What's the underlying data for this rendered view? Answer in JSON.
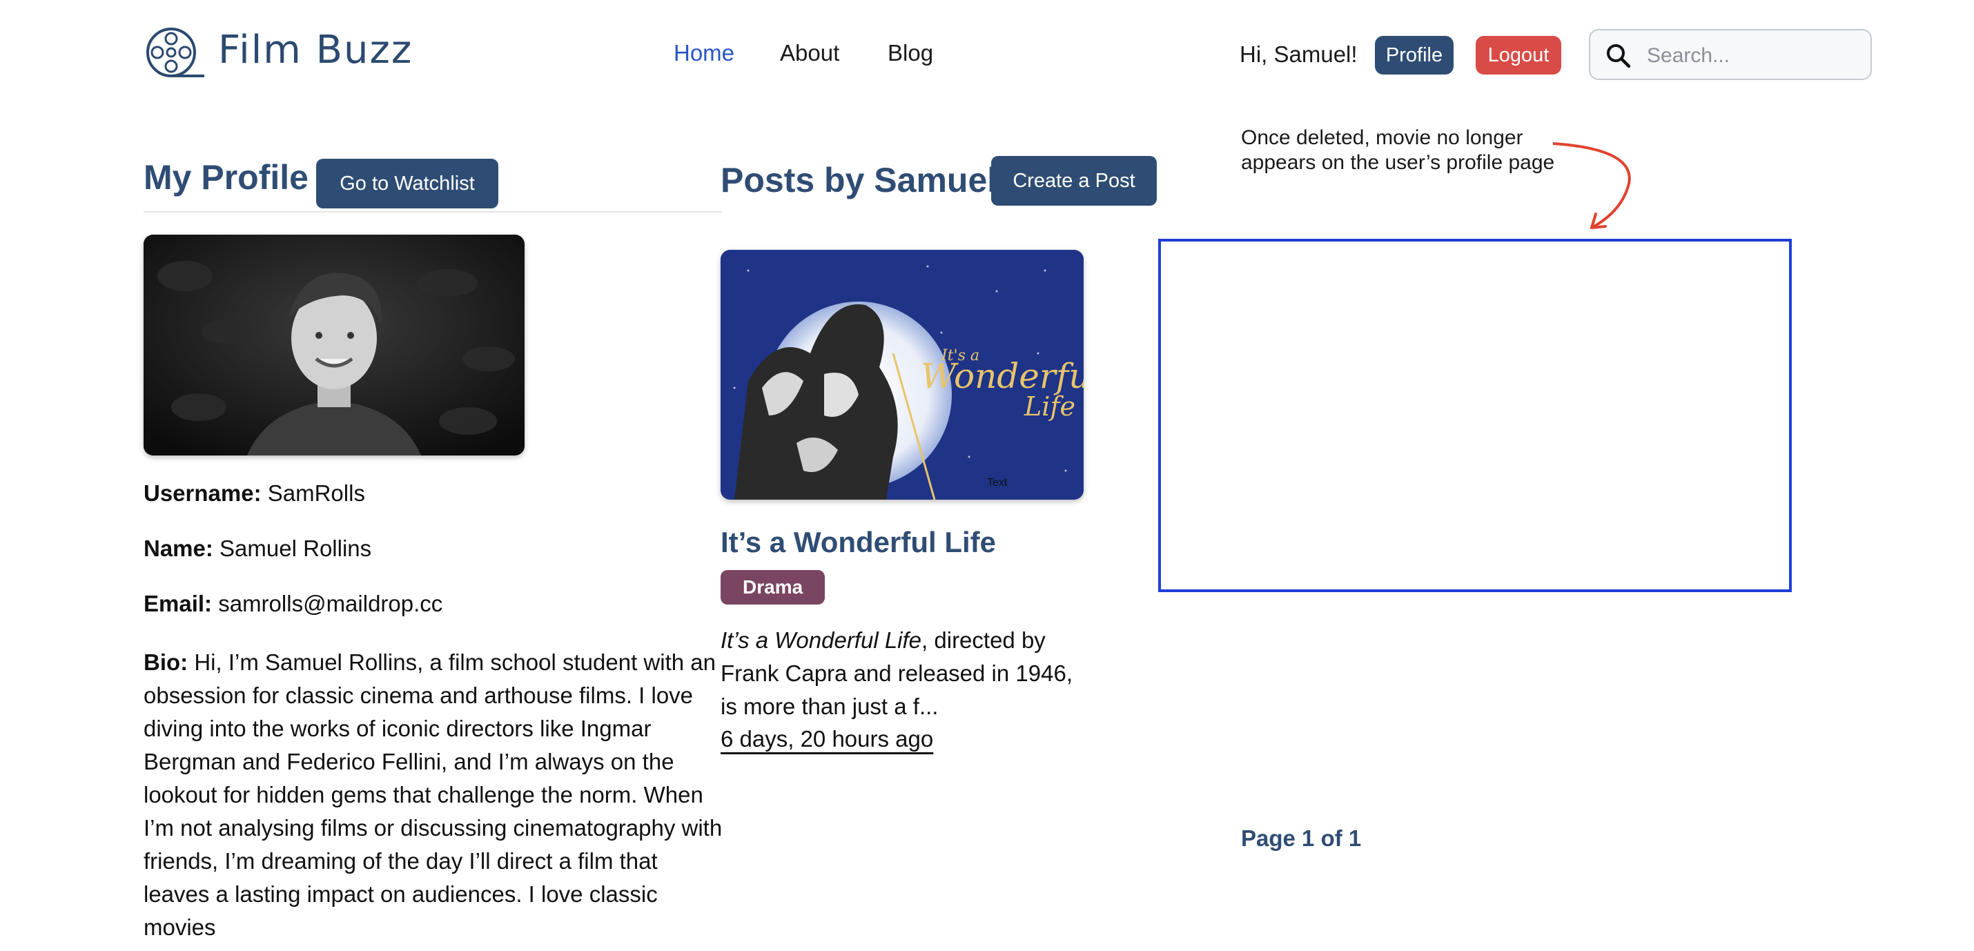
{
  "header": {
    "brand": "Film Buzz",
    "nav": [
      {
        "label": "Home",
        "active": true
      },
      {
        "label": "About",
        "active": false
      },
      {
        "label": "Blog",
        "active": false
      }
    ],
    "greeting": "Hi, Samuel!",
    "profile_label": "Profile",
    "logout_label": "Logout",
    "search_placeholder": "Search..."
  },
  "profile": {
    "title": "My Profile",
    "watchlist_label": "Go to Watchlist",
    "fields": [
      {
        "label": "Username:",
        "value": "SamRolls"
      },
      {
        "label": "Name:",
        "value": "Samuel Rollins"
      },
      {
        "label": "Email:",
        "value": "samrolls@maildrop.cc"
      }
    ],
    "bio_label": "Bio:",
    "bio": "Hi, I’m Samuel Rollins, a film school student with an obsession for classic cinema and arthouse films. I love diving into the works of iconic directors like Ingmar Bergman and Federico Fellini, and I’m always on the lookout for hidden gems that challenge the norm. When I’m not analysing films or discussing cinematography with friends, I’m dreaming of the day I’ll direct a film that leaves a lasting impact on audiences. I love classic movies"
  },
  "posts": {
    "title": "Posts by Samuel",
    "create_label": "Create a Post",
    "items": [
      {
        "poster_title_small": "It's a",
        "poster_title_big": "Wonderful",
        "poster_title_last": "Life",
        "poster_caption": "Text",
        "title": "It’s a Wonderful Life",
        "genre": "Drama",
        "excerpt_italic": "It’s a Wonderful Life",
        "excerpt_rest": ", directed by Frank Capra and released in 1946, is more than just a f...",
        "time": "6 days, 20 hours ago"
      }
    ],
    "pagination": "Page 1 of 1"
  },
  "annotation": {
    "text": "Once deleted, movie no longer appears on the user’s profile page",
    "arrow_color": "#e0432f",
    "box_color": "#1f3fd8"
  },
  "colors": {
    "primary": "#2f4d74",
    "danger": "#d94b47",
    "link_active": "#2a55c6",
    "genre_badge": "#7a4560"
  }
}
